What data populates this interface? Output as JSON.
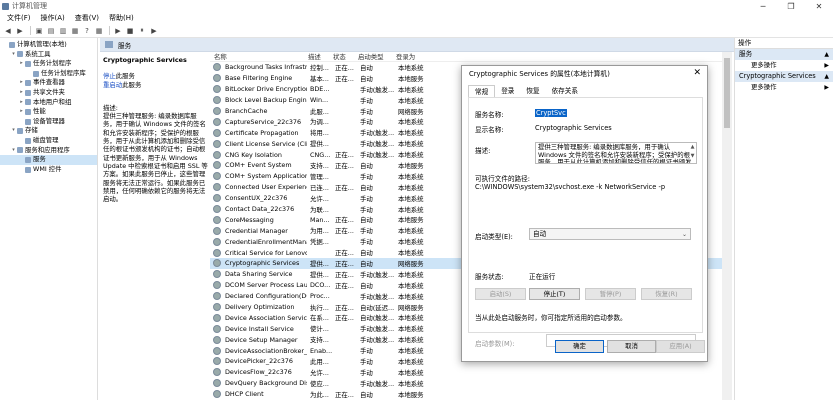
{
  "window": {
    "title": "计算机管理",
    "buttons": [
      "─",
      "❐",
      "✕"
    ]
  },
  "menu": [
    "文件(F)",
    "操作(A)",
    "查看(V)",
    "帮助(H)"
  ],
  "toolbar": [
    "◀",
    "▶",
    "▣",
    "▤",
    "▥",
    "▦",
    "?",
    "▦",
    "▶",
    "■",
    "⏸",
    "▶"
  ],
  "tree": [
    {
      "label": "计算机管理(本地)",
      "indent": 0,
      "arrow": ""
    },
    {
      "label": "系统工具",
      "indent": 1,
      "arrow": "▾"
    },
    {
      "label": "任务计划程序",
      "indent": 2,
      "arrow": "▸"
    },
    {
      "label": "任务计划程序库",
      "indent": 3,
      "arrow": ""
    },
    {
      "label": "事件查看器",
      "indent": 2,
      "arrow": "▸"
    },
    {
      "label": "共享文件夹",
      "indent": 2,
      "arrow": "▸"
    },
    {
      "label": "本地用户和组",
      "indent": 2,
      "arrow": "▸"
    },
    {
      "label": "性能",
      "indent": 2,
      "arrow": "▸"
    },
    {
      "label": "设备管理器",
      "indent": 2,
      "arrow": ""
    },
    {
      "label": "存储",
      "indent": 1,
      "arrow": "▾"
    },
    {
      "label": "磁盘管理",
      "indent": 2,
      "arrow": ""
    },
    {
      "label": "服务和应用程序",
      "indent": 1,
      "arrow": "▾"
    },
    {
      "label": "服务",
      "indent": 2,
      "arrow": "",
      "selected": true
    },
    {
      "label": "WMI 控件",
      "indent": 2,
      "arrow": ""
    }
  ],
  "main": {
    "header": "服务",
    "service_name": "Cryptographic Services",
    "action_stop": "停止",
    "action_stop_suffix": "此服务",
    "action_restart": "重启动",
    "action_restart_suffix": "此服务",
    "desc_label": "描述:",
    "desc_text": "提供三种管理服务: 编录数据库服务，用于确认 Windows 文件的签名和允许安装新程序；受保护的根服务，用于从此计算机添加和删除受信任的根证书颁发机构的证书；自动根证书更新服务，用于从 Windows Update 中检索根证书和启用 SSL 等方案。如果此服务已停止，这些管理服务将无法正常运行。如果此服务已禁用，任何明确依赖它的服务将无法启动。"
  },
  "columns": [
    "名称",
    "描述",
    "状态",
    "启动类型",
    "登录为"
  ],
  "rows": [
    [
      "Background Tasks Infrastru...",
      "控制...",
      "正在...",
      "自动",
      "本地系统"
    ],
    [
      "Base Filtering Engine",
      "基本...",
      "正在...",
      "自动",
      "本地服务"
    ],
    [
      "BitLocker Drive Encryption ...",
      "BDE...",
      "",
      "手动(触发...",
      "本地系统"
    ],
    [
      "Block Level Backup Engine ...",
      "Win...",
      "",
      "手动",
      "本地系统"
    ],
    [
      "BranchCache",
      "此服...",
      "",
      "手动",
      "网络服务"
    ],
    [
      "CaptureService_22c376",
      "为调...",
      "",
      "手动",
      "本地系统"
    ],
    [
      "Certificate Propagation",
      "将用...",
      "",
      "手动(触发...",
      "本地系统"
    ],
    [
      "Client License Service (Clip...",
      "提供...",
      "",
      "手动(触发...",
      "本地系统"
    ],
    [
      "CNG Key Isolation",
      "CNG...",
      "正在...",
      "手动(触发...",
      "本地系统"
    ],
    [
      "COM+ Event System",
      "支持...",
      "正在...",
      "自动",
      "本地服务"
    ],
    [
      "COM+ System Application",
      "管理...",
      "",
      "手动",
      "本地系统"
    ],
    [
      "Connected User Experienc...",
      "已连...",
      "正在...",
      "自动",
      "本地系统"
    ],
    [
      "ConsentUX_22c376",
      "允许...",
      "",
      "手动",
      "本地系统"
    ],
    [
      "Contact Data_22c376",
      "为联...",
      "",
      "手动",
      "本地系统"
    ],
    [
      "CoreMessaging",
      "Man...",
      "正在...",
      "自动",
      "本地服务"
    ],
    [
      "Credential Manager",
      "为用...",
      "正在...",
      "手动",
      "本地系统"
    ],
    [
      "CredentialEnrollmentMana...",
      "凭据...",
      "",
      "手动",
      "本地系统"
    ],
    [
      "Critical Service for Lenovo ...",
      "",
      "正在...",
      "自动",
      "本地系统"
    ],
    [
      "Cryptographic Services",
      "提供...",
      "正在...",
      "自动",
      "网络服务"
    ],
    [
      "Data Sharing Service",
      "提供...",
      "正在...",
      "手动(触发...",
      "本地系统"
    ],
    [
      "DCOM Server Process Lau...",
      "DCO...",
      "正在...",
      "自动",
      "本地系统"
    ],
    [
      "Declared Configuration(DC...",
      "Proc...",
      "",
      "手动(触发...",
      "本地系统"
    ],
    [
      "Delivery Optimization",
      "执行...",
      "正在...",
      "自动(延迟...",
      "网络服务"
    ],
    [
      "Device Association Service",
      "在系...",
      "正在...",
      "自动(触发...",
      "本地系统"
    ],
    [
      "Device Install Service",
      "使计...",
      "",
      "手动(触发...",
      "本地系统"
    ],
    [
      "Device Setup Manager",
      "支持...",
      "",
      "手动(触发...",
      "本地系统"
    ],
    [
      "DeviceAssociationBroker_2...",
      "Enab...",
      "",
      "手动",
      "本地系统"
    ],
    [
      "DevicePicker_22c376",
      "此用...",
      "",
      "手动",
      "本地系统"
    ],
    [
      "DevicesFlow_22c376",
      "允许...",
      "",
      "手动",
      "本地系统"
    ],
    [
      "DevQuery Background Disc...",
      "使应...",
      "",
      "手动(触发...",
      "本地系统"
    ],
    [
      "DHCP Client",
      "为此...",
      "正在...",
      "自动",
      "本地服务"
    ]
  ],
  "actions": {
    "header": "操作",
    "group1": "服务",
    "more1": "更多操作",
    "group2": "Cryptographic Services",
    "more2": "更多操作"
  },
  "dialog": {
    "title": "Cryptographic Services 的属性(本地计算机)",
    "tabs": [
      "常规",
      "登录",
      "恢复",
      "依存关系"
    ],
    "service_name_label": "服务名称:",
    "service_name": "CryptSvc",
    "display_name_label": "显示名称:",
    "display_name": "Cryptographic Services",
    "desc_label": "描述:",
    "desc_text": "提供三种管理服务: 编录数据库服务，用于确认 Windows 文件的签名和允许安装新程序；受保护的根服务，用于从此计算机添加和删除受信任的根证书颁发机构的证书",
    "path_label": "可执行文件的路径:",
    "path": "C:\\WINDOWS\\system32\\svchost.exe -k NetworkService -p",
    "startup_label": "启动类型(E):",
    "startup_value": "自动",
    "status_label": "服务状态:",
    "status_value": "正在运行",
    "btn_start": "启动(S)",
    "btn_stop": "停止(T)",
    "btn_pause": "暂停(P)",
    "btn_resume": "恢复(R)",
    "hint": "当从此处启动服务时，你可指定所适用的启动参数。",
    "param_label": "启动参数(M):",
    "ok": "确定",
    "cancel": "取消",
    "apply": "应用(A)"
  }
}
